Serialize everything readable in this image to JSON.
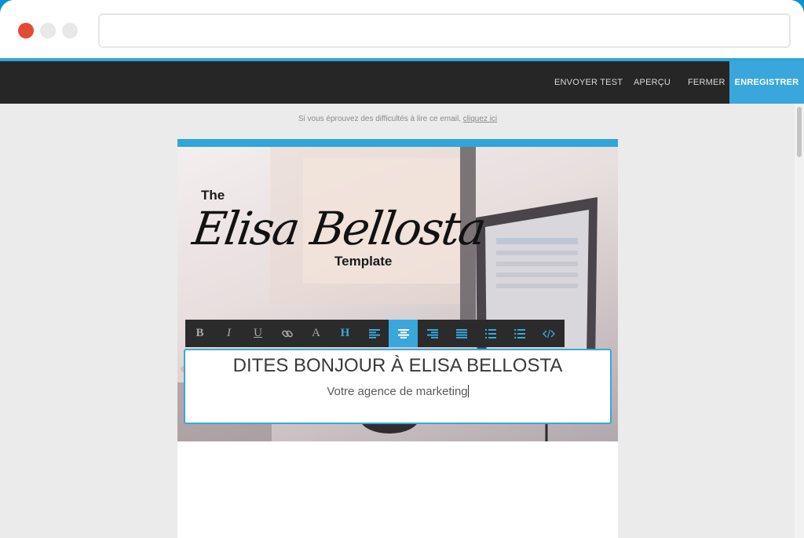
{
  "navbar": {
    "send_test": "ENVOYER TEST",
    "preview": "APERÇU",
    "close": "FERMER",
    "save": "ENREGISTRER"
  },
  "notice": {
    "text": "Si vous éprouvez des difficultés à lire ce email,",
    "link": "cliquez ici"
  },
  "hero": {
    "the": "The",
    "script": "Elisa Bellosta",
    "template": "Template"
  },
  "toolbar": {
    "bold": "B",
    "italic": "I",
    "underline": "U",
    "font": "A",
    "heading": "H",
    "active_button": "align-center"
  },
  "content": {
    "headline": "DITES BONJOUR À ELISA BELLOSTA",
    "subline": "Votre agence de marketing"
  },
  "colors": {
    "accent": "#3aa7dc",
    "navbar": "#262626",
    "close_dot": "#e34a33"
  }
}
